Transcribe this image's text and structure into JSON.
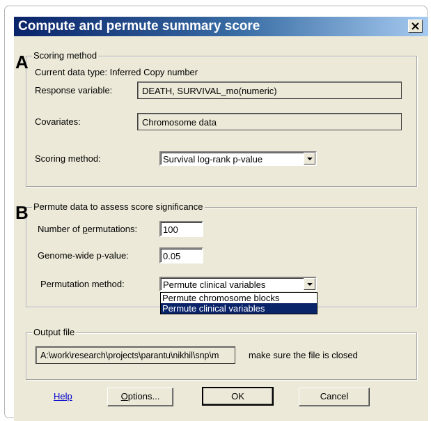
{
  "window": {
    "title": "Compute and permute summary score",
    "close_glyph": "✕"
  },
  "section_a": {
    "marker": "A",
    "legend": "Scoring method",
    "data_type": "Current data type: Inferred Copy number",
    "response_label": "Response variable:",
    "response_value": "DEATH, SURVIVAL_mo(numeric)",
    "covariates_label": "Covariates:",
    "covariates_value": "Chromosome data",
    "scoring_label": "Scoring method:",
    "scoring_value": "Survival log-rank p-value"
  },
  "section_b": {
    "marker": "B",
    "legend": "Permute data to assess score significance",
    "num_perm_label_pre": "Number of ",
    "num_perm_label_key": "p",
    "num_perm_label_post": "ermutations:",
    "num_perm_value": "100",
    "pvalue_label": "Genome-wide p-value:",
    "pvalue_value": "0.05",
    "method_label": "Permutation method:",
    "method_value": "Permute clinical variables",
    "method_options": [
      "Permute chromosome blocks",
      "Permute clinical variables"
    ],
    "method_selected_index": 1
  },
  "output": {
    "legend": "Output file",
    "path": "A:\\work\\research\\projects\\parantu\\nikhil\\snp\\m",
    "note": "make sure the file is closed"
  },
  "buttons": {
    "help": "Help",
    "options_key": "O",
    "options_rest": "ptions...",
    "ok": "OK",
    "cancel": "Cancel"
  },
  "colors": {
    "titlebar_start": "#0a246a",
    "titlebar_end": "#a6caf0",
    "dialog_bg": "#ece9d8",
    "selection": "#0a246a"
  }
}
